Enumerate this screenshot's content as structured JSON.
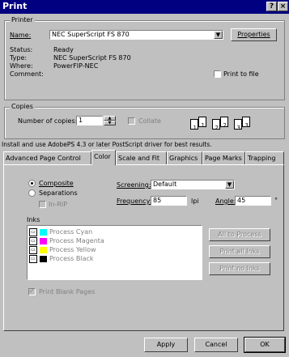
{
  "window": {
    "title": "Print",
    "help_label": "?",
    "close_label": "×"
  },
  "printer": {
    "group_label": "Printer",
    "name_label": "Name:",
    "name_value": "NEC SuperScript FS 870",
    "properties_label": "Properties",
    "status_label": "Status:",
    "status_value": "Ready",
    "type_label": "Type:",
    "type_value": "NEC SuperScript FS 870",
    "where_label": "Where:",
    "where_value": "PowerFIP-NEC",
    "comment_label": "Comment:",
    "print_to_file_label": "Print to file",
    "print_to_file_checked": false
  },
  "copies": {
    "group_label": "Copies",
    "number_label": "Number of copies:",
    "number_value": "1",
    "collate_label": "Collate",
    "collate_checked": false,
    "collate_icons": [
      "1",
      "1",
      "2",
      "2",
      "3",
      "3"
    ]
  },
  "notice": "Install and use AdobePS 4.3 or later PostScript driver for best results.",
  "tabs": [
    {
      "label": "Advanced Page Control",
      "active": false
    },
    {
      "label": "Color",
      "active": true
    },
    {
      "label": "Scale and Fit",
      "active": false
    },
    {
      "label": "Graphics",
      "active": false
    },
    {
      "label": "Page Marks",
      "active": false
    },
    {
      "label": "Trapping",
      "active": false
    }
  ],
  "color": {
    "composite_label": "Composite",
    "separations_label": "Separations",
    "selected_mode": "Composite",
    "in_rip_label": "In-RIP",
    "screening_label": "Screening:",
    "screening_value": "Default",
    "frequency_label": "Frequency:",
    "frequency_value": "85",
    "frequency_unit": "lpi",
    "angle_label": "Angle:",
    "angle_value": "45",
    "angle_unit": "°",
    "inks_label": "Inks",
    "inks": [
      {
        "name": "Process Cyan",
        "color": "#00ffff"
      },
      {
        "name": "Process Magenta",
        "color": "#ff00ff"
      },
      {
        "name": "Process Yellow",
        "color": "#ffff00"
      },
      {
        "name": "Process Black",
        "color": "#000000"
      }
    ],
    "all_to_process_label": "All to Process",
    "print_all_inks_label": "Print all Inks",
    "print_no_inks_label": "Print no Inks",
    "print_blank_label": "Print Blank Pages",
    "print_blank_checked": true
  },
  "footer": {
    "apply_label": "Apply",
    "cancel_label": "Cancel",
    "ok_label": "OK"
  }
}
